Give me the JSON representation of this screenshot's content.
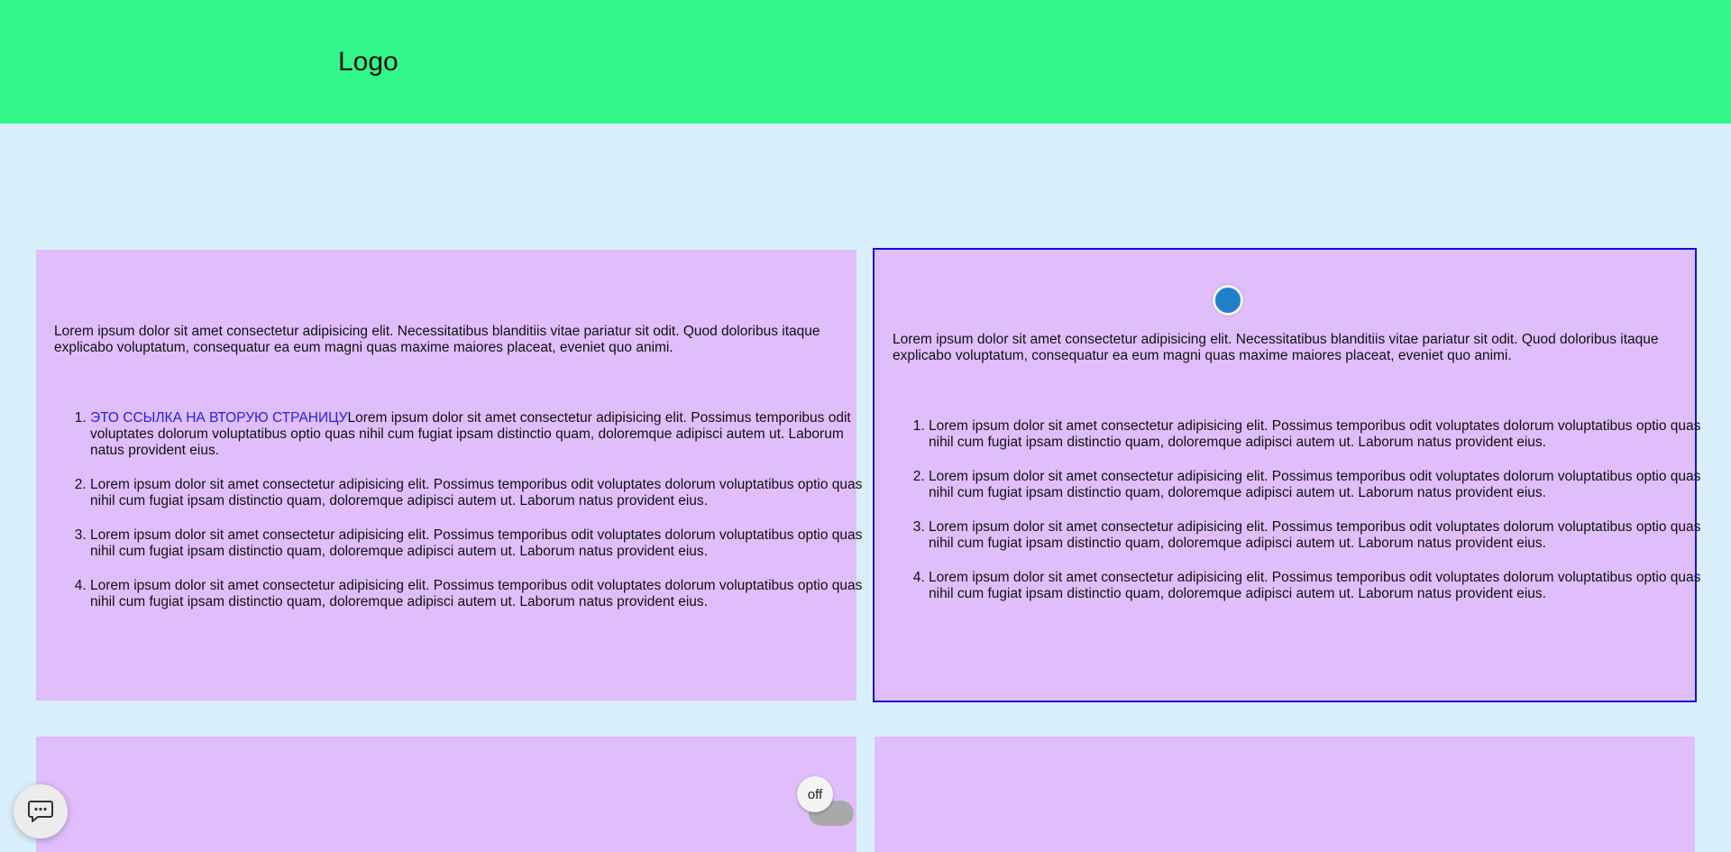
{
  "header": {
    "logo": "Logo",
    "background": "#31f78a"
  },
  "cards": [
    {
      "paragraph": "Lorem ipsum dolor sit amet consectetur adipisicing elit. Necessitatibus blanditiis vitae pariatur sit odit. Quod doloribus itaque explicabo voluptatum, consequatur ea eum magni quas maxime maiores placeat, eveniet quo animi.",
      "link_text": "ЭТО ССЫЛКА НА ВТОРУЮ СТРАНИЦУ",
      "items": [
        "Lorem ipsum dolor sit amet consectetur adipisicing elit. Possimus temporibus odit voluptates dolorum voluptatibus optio quas nihil cum fugiat ipsam distinctio quam, doloremque adipisci autem ut. Laborum natus provident eius.",
        "Lorem ipsum dolor sit amet consectetur adipisicing elit. Possimus temporibus odit voluptates dolorum voluptatibus optio quas nihil cum fugiat ipsam distinctio quam, doloremque adipisci autem ut. Laborum natus provident eius.",
        "Lorem ipsum dolor sit amet consectetur adipisicing elit. Possimus temporibus odit voluptates dolorum voluptatibus optio quas nihil cum fugiat ipsam distinctio quam, doloremque adipisci autem ut. Laborum natus provident eius.",
        "Lorem ipsum dolor sit amet consectetur adipisicing elit. Possimus temporibus odit voluptates dolorum voluptatibus optio quas nihil cum fugiat ipsam distinctio quam, doloremque adipisci autem ut. Laborum natus provident eius."
      ]
    },
    {
      "paragraph": "Lorem ipsum dolor sit amet consectetur adipisicing elit. Necessitatibus blanditiis vitae pariatur sit odit. Quod doloribus itaque explicabo voluptatum, consequatur ea eum magni quas maxime maiores placeat, eveniet quo animi.",
      "items": [
        "Lorem ipsum dolor sit amet consectetur adipisicing elit. Possimus temporibus odit voluptates dolorum voluptatibus optio quas nihil cum fugiat ipsam distinctio quam, doloremque adipisci autem ut. Laborum natus provident eius.",
        "Lorem ipsum dolor sit amet consectetur adipisicing elit. Possimus temporibus odit voluptates dolorum voluptatibus optio quas nihil cum fugiat ipsam distinctio quam, doloremque adipisci autem ut. Laborum natus provident eius.",
        "Lorem ipsum dolor sit amet consectetur adipisicing elit. Possimus temporibus odit voluptates dolorum voluptatibus optio quas nihil cum fugiat ipsam distinctio quam, doloremque adipisci autem ut. Laborum natus provident eius.",
        "Lorem ipsum dolor sit amet consectetur adipisicing elit. Possimus temporibus odit voluptates dolorum voluptatibus optio quas nihil cum fugiat ipsam distinctio quam, doloremque adipisci autem ut. Laborum natus provident eius."
      ]
    }
  ],
  "toggle": {
    "label": "off"
  },
  "chat": {
    "icon": "chat-bubble-icon"
  },
  "colors": {
    "page_bg": "#d9effc",
    "card_bg": "#dfbefb",
    "selected_border": "#1a0fc9",
    "link": "#2a1ee0",
    "dot": "#2081c8"
  }
}
